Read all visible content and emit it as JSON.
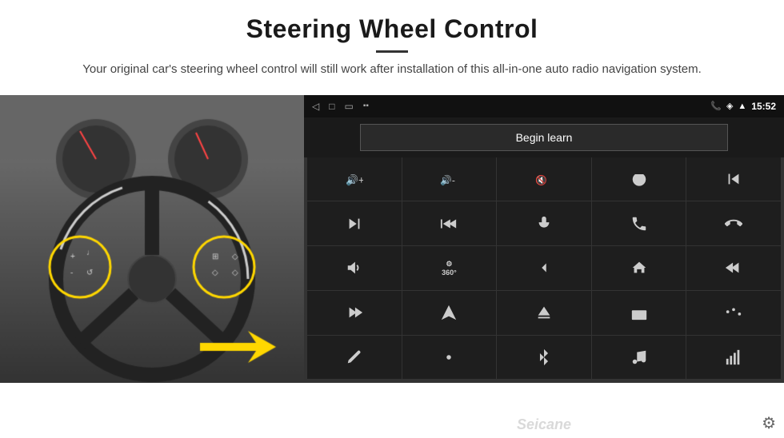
{
  "header": {
    "title": "Steering Wheel Control",
    "subtitle": "Your original car's steering wheel control will still work after installation of this all-in-one auto radio navigation system.",
    "divider": true
  },
  "status_bar": {
    "back_icon": "◁",
    "home_icon": "□",
    "recents_icon": "▭",
    "signal_icon": "▪▪",
    "phone_icon": "📞",
    "location_icon": "◈",
    "wifi_icon": "▲",
    "time": "15:52"
  },
  "begin_learn": {
    "label": "Begin learn"
  },
  "controls": [
    {
      "icon": "vol_up",
      "unicode": "🔊+"
    },
    {
      "icon": "vol_down",
      "unicode": "🔊-"
    },
    {
      "icon": "mute",
      "unicode": "🔇"
    },
    {
      "icon": "power",
      "unicode": "⏻"
    },
    {
      "icon": "prev_track",
      "unicode": "⏮"
    },
    {
      "icon": "next_track",
      "unicode": "⏭"
    },
    {
      "icon": "ff_prev",
      "unicode": "⏪"
    },
    {
      "icon": "mic",
      "unicode": "🎤"
    },
    {
      "icon": "phone",
      "unicode": "📞"
    },
    {
      "icon": "end_call",
      "unicode": "📵"
    },
    {
      "icon": "horn",
      "unicode": "📢"
    },
    {
      "icon": "360",
      "unicode": "360"
    },
    {
      "icon": "back",
      "unicode": "↩"
    },
    {
      "icon": "home",
      "unicode": "⌂"
    },
    {
      "icon": "rewind",
      "unicode": "⏮"
    },
    {
      "icon": "fast_fwd",
      "unicode": "⏭"
    },
    {
      "icon": "nav",
      "unicode": "▲"
    },
    {
      "icon": "eject",
      "unicode": "⏏"
    },
    {
      "icon": "radio",
      "unicode": "📻"
    },
    {
      "icon": "equalizer",
      "unicode": "🎚"
    },
    {
      "icon": "pen",
      "unicode": "✏"
    },
    {
      "icon": "settings2",
      "unicode": "⚙"
    },
    {
      "icon": "bluetooth",
      "unicode": "⚡"
    },
    {
      "icon": "music",
      "unicode": "🎵"
    },
    {
      "icon": "bars",
      "unicode": "📶"
    }
  ],
  "watermark": "Seicane",
  "gear_icon": "⚙"
}
